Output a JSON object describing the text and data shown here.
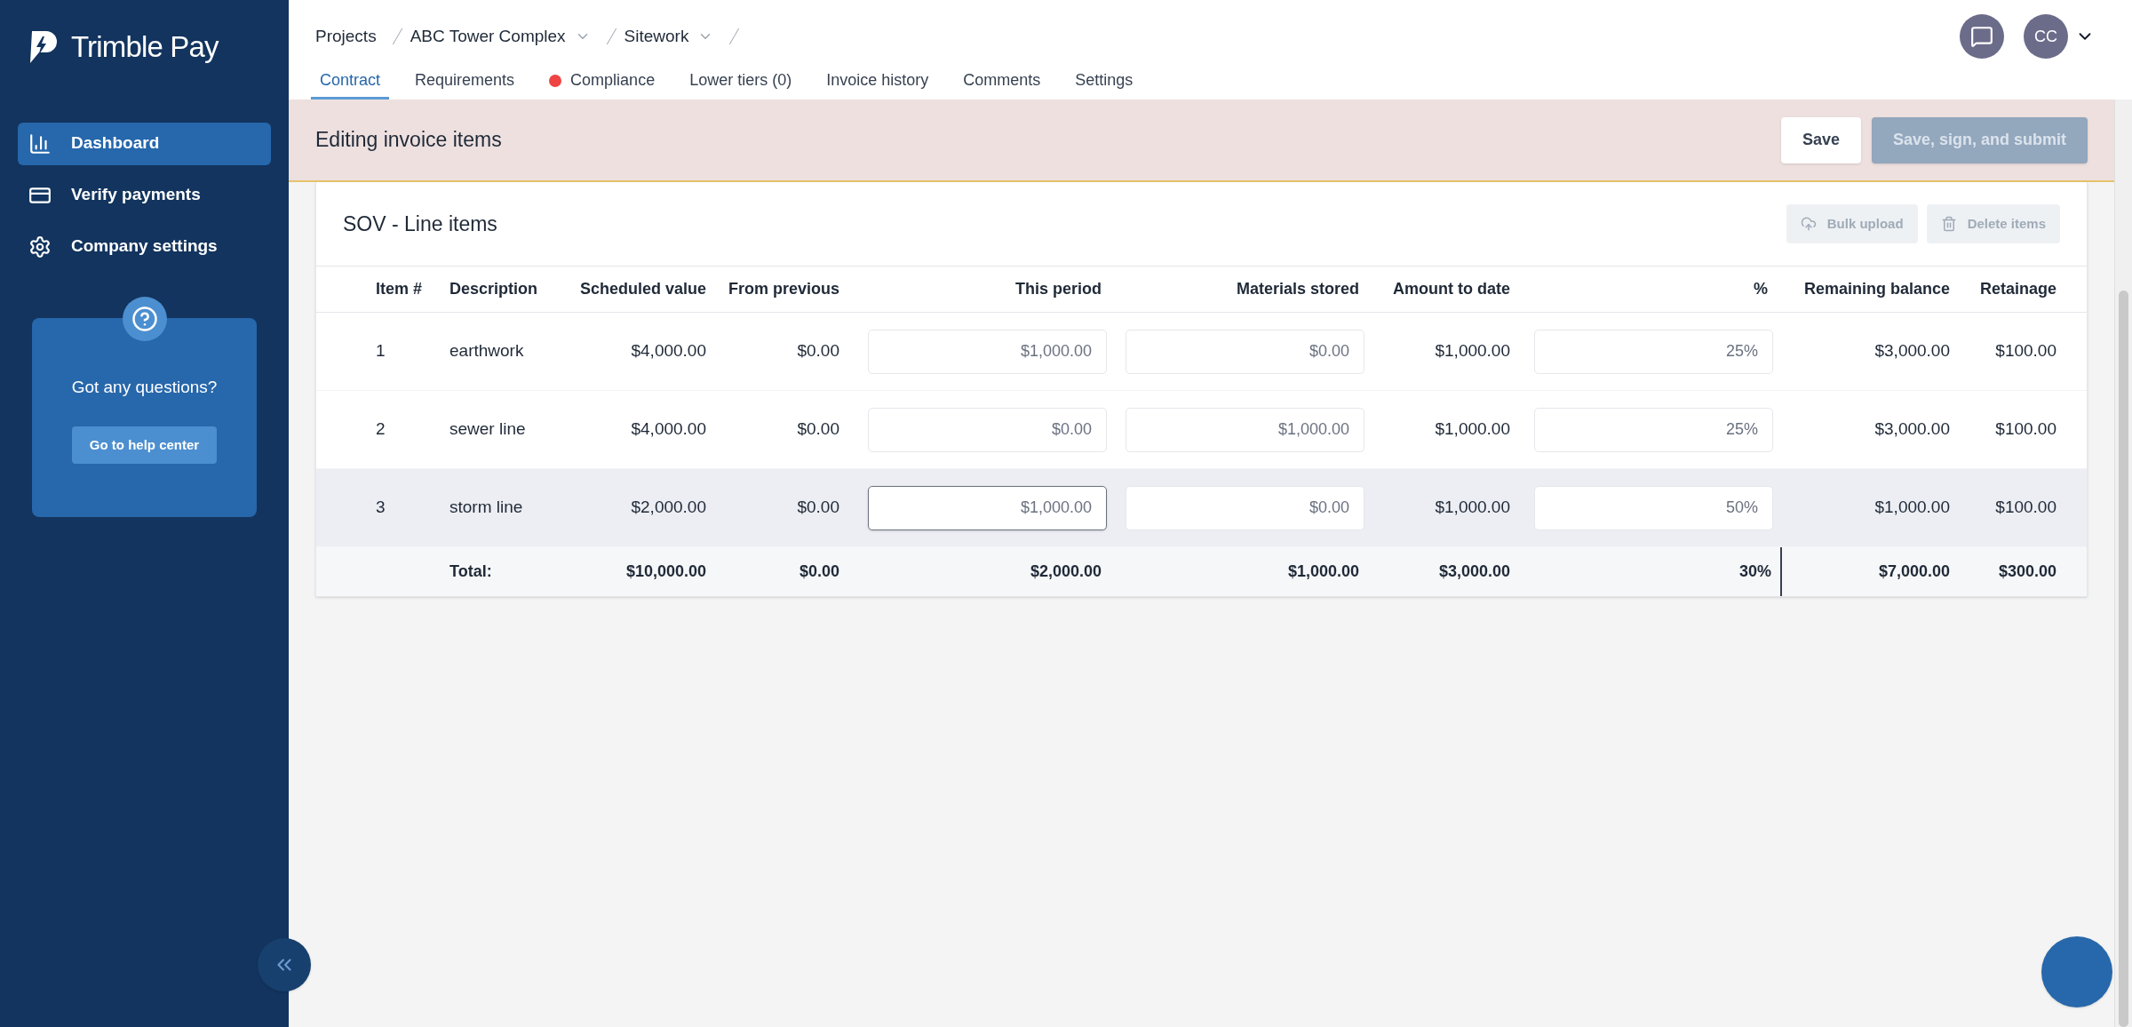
{
  "sidebar": {
    "brand": "Trimble Pay",
    "items": [
      {
        "label": "Dashboard",
        "kind": "chart",
        "selected": true
      },
      {
        "label": "Verify payments",
        "kind": "card",
        "selected": false
      },
      {
        "label": "Company settings",
        "kind": "gear",
        "selected": false
      }
    ],
    "help": {
      "title": "Got any questions?",
      "button": "Go to help center"
    }
  },
  "breadcrumb": [
    {
      "label": "Projects",
      "dropdown": false
    },
    {
      "label": "ABC Tower Complex",
      "dropdown": true
    },
    {
      "label": "Sitework",
      "dropdown": true
    }
  ],
  "user": {
    "initials": "CC"
  },
  "tabs": [
    {
      "label": "Contract",
      "selected": true,
      "alert": false
    },
    {
      "label": "Requirements",
      "selected": false,
      "alert": false
    },
    {
      "label": "Compliance",
      "selected": false,
      "alert": true
    },
    {
      "label": "Lower tiers (0)",
      "selected": false,
      "alert": false
    },
    {
      "label": "Invoice history",
      "selected": false,
      "alert": false
    },
    {
      "label": "Comments",
      "selected": false,
      "alert": false
    },
    {
      "label": "Settings",
      "selected": false,
      "alert": false
    }
  ],
  "banner": {
    "title": "Editing invoice items",
    "buttons": [
      {
        "label": "Save",
        "disabled": false
      },
      {
        "label": "Save, sign, and submit",
        "disabled": true
      }
    ]
  },
  "card": {
    "title": "SOV - Line items",
    "actions": [
      {
        "label": "Bulk upload",
        "kind": "upload",
        "disabled": true
      },
      {
        "label": "Delete items",
        "kind": "delete",
        "disabled": true
      }
    ]
  },
  "table": {
    "columns": [
      "Item #",
      "Description",
      "Scheduled value",
      "From previous",
      "This period",
      "Materials stored",
      "Amount to date",
      "%",
      "Remaining balance",
      "Retainage"
    ],
    "rows": [
      {
        "item": "1",
        "description": "earthwork",
        "scheduled_value": "$4,000.00",
        "from_previous": "$0.00",
        "this_period": {
          "value": "$1,000.00",
          "focused": false
        },
        "materials_stored": {
          "value": "$0.00",
          "focused": false
        },
        "amount_to_date": "$1,000.00",
        "percent": {
          "value": "25%",
          "focused": false
        },
        "remaining_balance": "$3,000.00",
        "retainage": "$100.00",
        "selected": false
      },
      {
        "item": "2",
        "description": "sewer line",
        "scheduled_value": "$4,000.00",
        "from_previous": "$0.00",
        "this_period": {
          "value": "$0.00",
          "focused": false
        },
        "materials_stored": {
          "value": "$1,000.00",
          "focused": false
        },
        "amount_to_date": "$1,000.00",
        "percent": {
          "value": "25%",
          "focused": false
        },
        "remaining_balance": "$3,000.00",
        "retainage": "$100.00",
        "selected": false
      },
      {
        "item": "3",
        "description": "storm line",
        "scheduled_value": "$2,000.00",
        "from_previous": "$0.00",
        "this_period": {
          "value": "$1,000.00",
          "focused": true
        },
        "materials_stored": {
          "value": "$0.00",
          "focused": false
        },
        "amount_to_date": "$1,000.00",
        "percent": {
          "value": "50%",
          "focused": false
        },
        "remaining_balance": "$1,000.00",
        "retainage": "$100.00",
        "selected": true
      }
    ],
    "total": {
      "label": "Total:",
      "scheduled_value": "$10,000.00",
      "from_previous": "$0.00",
      "this_period": "$2,000.00",
      "materials_stored": "$1,000.00",
      "amount_to_date": "$3,000.00",
      "percent": "30%",
      "remaining_balance": "$7,000.00",
      "retainage": "$300.00"
    }
  }
}
